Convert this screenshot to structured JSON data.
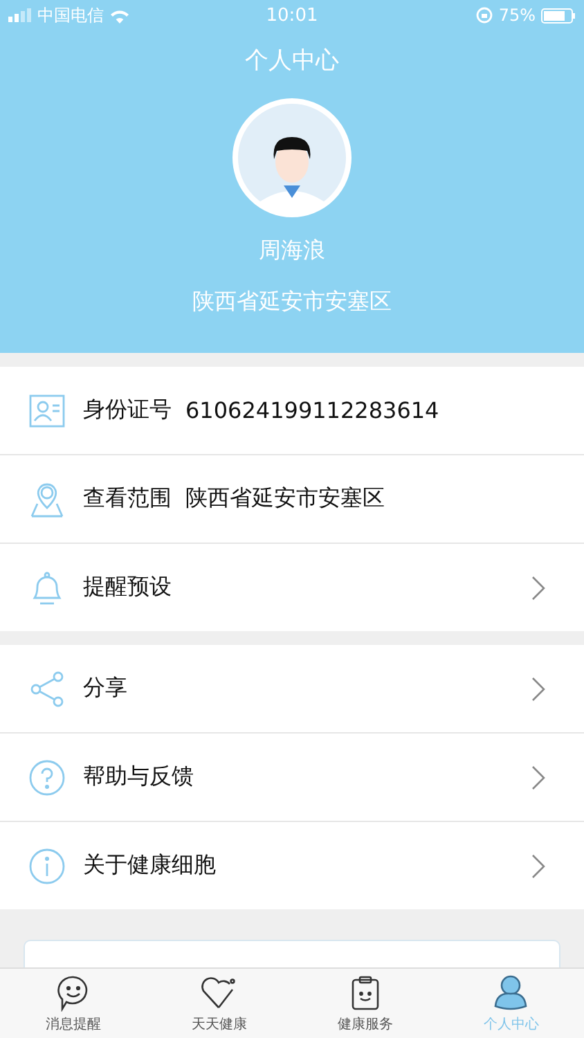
{
  "status_bar": {
    "carrier": "中国电信",
    "time": "10:01",
    "battery": "75%"
  },
  "title": "个人中心",
  "profile": {
    "name": "周海浪",
    "location": "陕西省延安市安塞区"
  },
  "groups": [
    {
      "rows": [
        {
          "label": "身份证号",
          "value": "610624199112283614",
          "chevron": false
        },
        {
          "label": "查看范围",
          "value": "陕西省延安市安塞区",
          "chevron": false
        },
        {
          "label": "提醒预设",
          "chevron": true
        }
      ]
    },
    {
      "rows": [
        {
          "label": "分享",
          "chevron": true
        },
        {
          "label": "帮助与反馈",
          "chevron": true
        },
        {
          "label": "关于健康细胞",
          "chevron": true
        }
      ]
    }
  ],
  "tabs": [
    {
      "label": "消息提醒",
      "selected": false
    },
    {
      "label": "天天健康",
      "selected": false
    },
    {
      "label": "健康服务",
      "selected": false
    },
    {
      "label": "个人中心",
      "selected": true
    }
  ]
}
